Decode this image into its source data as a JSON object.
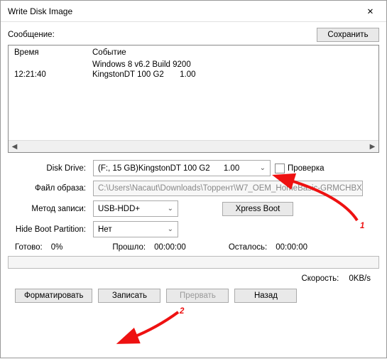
{
  "titlebar": {
    "title": "Write Disk Image"
  },
  "messageLabel": "Сообщение:",
  "saveButton": "Сохранить",
  "log": {
    "headers": {
      "time": "Время",
      "event": "Событие"
    },
    "rows": [
      {
        "time": "",
        "event": "Windows 8 v6.2 Build 9200"
      },
      {
        "time": "12:21:40",
        "event": "KingstonDT 100 G2       1.00"
      }
    ]
  },
  "form": {
    "diskDriveLabel": "Disk Drive:",
    "diskDriveValue": "(F:, 15 GB)KingstonDT 100 G2      1.00",
    "checkLabel": "Проверка",
    "fileLabel": "Файл образа:",
    "fileValue": "C:\\Users\\Nacaut\\Downloads\\Торрент\\W7_OEM_HomeBasic-GRMCHBX",
    "methodLabel": "Метод записи:",
    "methodValue": "USB-HDD+",
    "xpressBoot": "Xpress Boot",
    "hideLabel": "Hide Boot Partition:",
    "hideValue": "Нет"
  },
  "status": {
    "readyLabel": "Готово:",
    "readyValue": "0%",
    "elapsedLabel": "Прошло:",
    "elapsedValue": "00:00:00",
    "remainingLabel": "Осталось:",
    "remainingValue": "00:00:00"
  },
  "speed": {
    "label": "Скорость:",
    "value": "0KB/s"
  },
  "buttons": {
    "format": "Форматировать",
    "write": "Записать",
    "abort": "Прервать",
    "back": "Назад"
  },
  "annotations": {
    "one": "1",
    "two": "2"
  }
}
